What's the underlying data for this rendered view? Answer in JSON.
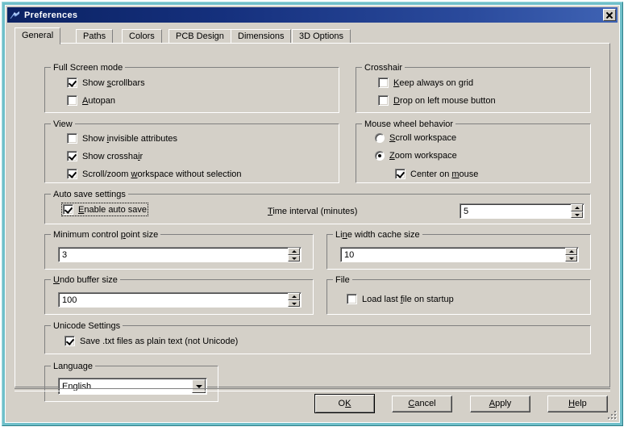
{
  "window": {
    "title": "Preferences",
    "icon": "app-icon",
    "close_label": "×",
    "frame_color": "#6fbfc9",
    "titlebar_color": "#0b2263",
    "face_color": "#d4d0c8"
  },
  "tabs": [
    {
      "label": "General",
      "active": true
    },
    {
      "label": "Paths",
      "active": false
    },
    {
      "label": "Colors",
      "active": false
    },
    {
      "label": "PCB Design",
      "active": false
    },
    {
      "label": "Dimensions",
      "active": false
    },
    {
      "label": "3D Options",
      "active": false
    }
  ],
  "groups": {
    "full_screen_mode": {
      "title": "Full Screen mode",
      "items": [
        {
          "label_pre": "Show ",
          "accel": "s",
          "label_post": "crollbars",
          "checked": true
        },
        {
          "label_pre": "",
          "accel": "A",
          "label_post": "utopan",
          "checked": false
        }
      ]
    },
    "view": {
      "title": "View",
      "items": [
        {
          "label_pre": "Show ",
          "accel": "i",
          "label_post": "nvisible attributes",
          "checked": false
        },
        {
          "label_pre": "Show crossha",
          "accel": "i",
          "label_post": "r",
          "checked": true
        },
        {
          "label_pre": "Scroll/zoom ",
          "accel": "w",
          "label_post": "orkspace without selection",
          "checked": true
        }
      ]
    },
    "crosshair": {
      "title": "Crosshair",
      "items": [
        {
          "label_pre": "",
          "accel": "K",
          "label_post": "eep always on grid",
          "checked": false
        },
        {
          "label_pre": "",
          "accel": "D",
          "label_post": "rop on left mouse button",
          "checked": false
        }
      ]
    },
    "mouse_wheel": {
      "title": "Mouse wheel behavior",
      "radios": [
        {
          "label_pre": "",
          "accel": "S",
          "label_post": "croll workspace",
          "selected": false
        },
        {
          "label_pre": "",
          "accel": "Z",
          "label_post": "oom workspace",
          "selected": true
        }
      ],
      "checkbox": {
        "label_pre": "Center on ",
        "accel": "m",
        "label_post": "ouse",
        "checked": true
      }
    },
    "auto_save": {
      "title": "Auto save settings",
      "checkbox": {
        "label_pre": "",
        "accel": "E",
        "label_post": "nable auto save",
        "checked": true,
        "focused": true
      },
      "interval_label_pre": "",
      "interval_accel": "T",
      "interval_label_post": "ime interval (minutes)",
      "interval_value": "5"
    },
    "min_control_point": {
      "title_pre": "Minimum control ",
      "title_accel": "p",
      "title_post": "oint size",
      "value": "3"
    },
    "line_width_cache": {
      "title_pre": "Li",
      "title_accel": "n",
      "title_post": "e width cache size",
      "value": "10"
    },
    "undo_buffer": {
      "title_pre": "",
      "title_accel": "U",
      "title_post": "ndo buffer size",
      "value": "100"
    },
    "file": {
      "title": "File",
      "checkbox": {
        "label_pre": "Load last ",
        "accel": "f",
        "label_post": "ile on startup",
        "checked": false
      }
    },
    "unicode": {
      "title": "Unicode Settings",
      "checkbox": {
        "label_pre": "Save .txt files as plain text (not Unicode)",
        "accel": "",
        "label_post": "",
        "checked": true
      }
    },
    "language": {
      "title": "Language",
      "value": "English",
      "options": [
        "English"
      ]
    }
  },
  "buttons": [
    {
      "pre": "O",
      "accel": "K",
      "post": "",
      "default": true
    },
    {
      "pre": "",
      "accel": "C",
      "post": "ancel",
      "default": false
    },
    {
      "pre": "",
      "accel": "A",
      "post": "pply",
      "default": false
    },
    {
      "pre": "",
      "accel": "H",
      "post": "elp",
      "default": false
    }
  ]
}
